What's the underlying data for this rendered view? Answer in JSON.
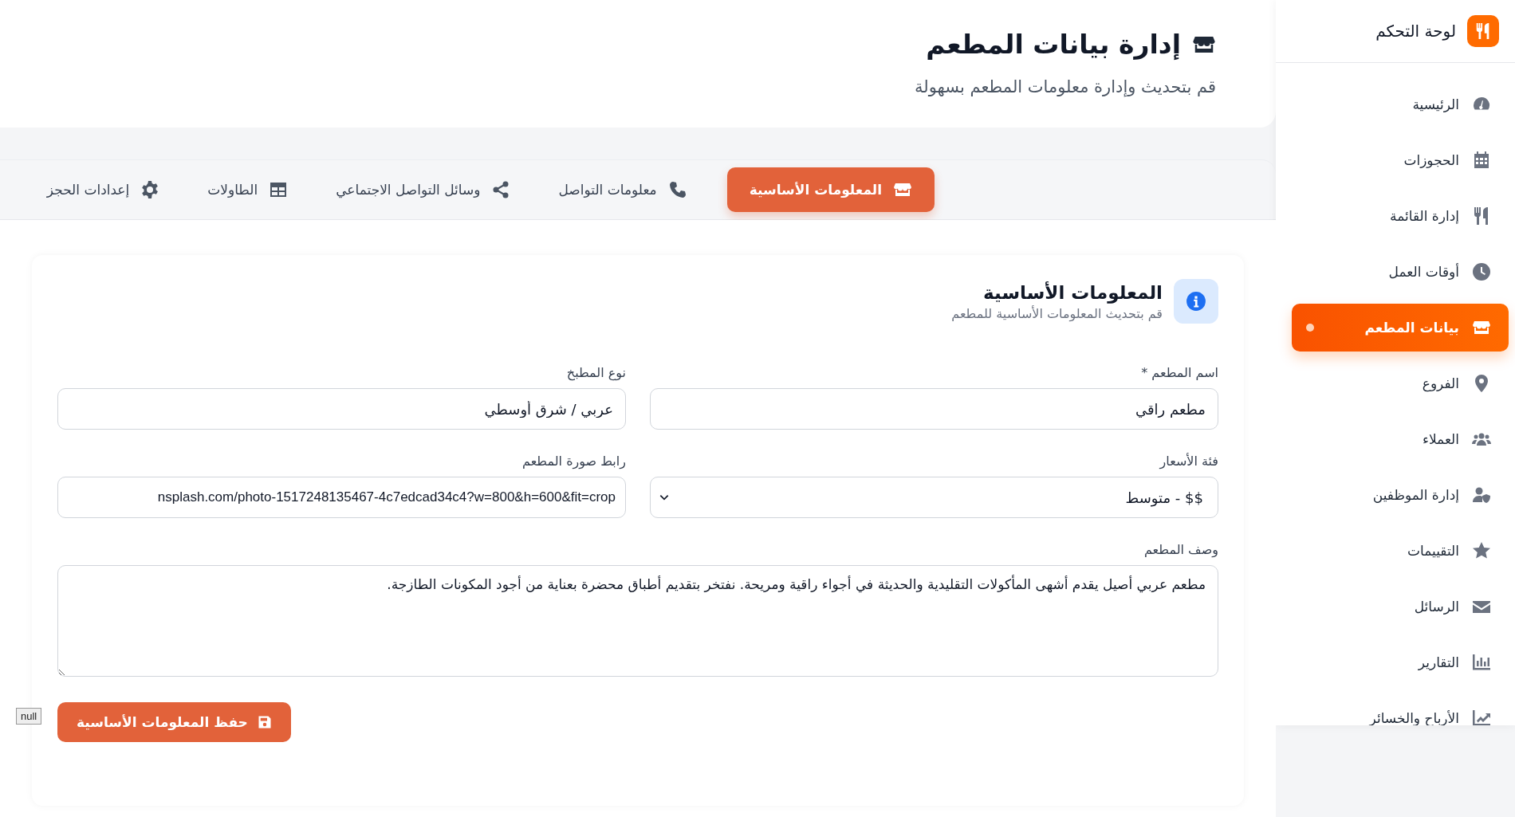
{
  "page_header": {
    "title": "إدارة بيانات المطعم",
    "subtitle": "قم بتحديث وإدارة معلومات المطعم بسهولة"
  },
  "tabs": [
    {
      "label": "المعلومات الأساسية",
      "kind": "store",
      "selected": true
    },
    {
      "label": "معلومات التواصل",
      "kind": "phone",
      "selected": false
    },
    {
      "label": "وسائل التواصل الاجتماعي",
      "kind": "share",
      "selected": false
    },
    {
      "label": "الطاولات",
      "kind": "table",
      "selected": false
    },
    {
      "label": "إعدادات الحجز",
      "kind": "gear",
      "selected": false
    }
  ],
  "section": {
    "title": "المعلومات الأساسية",
    "subtitle": "قم بتحديث المعلومات الأساسية للمطعم"
  },
  "fields": [
    {
      "kind": "input",
      "label": "اسم المطعم *",
      "value": "مطعم راقي"
    },
    {
      "kind": "input",
      "label": "نوع المطبخ",
      "value": "عربي / شرق أوسطي"
    },
    {
      "kind": "select",
      "label": "فئة الأسعار",
      "value": "$$ - متوسط"
    },
    {
      "kind": "url",
      "label": "رابط صورة المطعم",
      "value": "nsplash.com/photo-1517248135467-4c7edcad34c4?w=800&h=600&fit=crop"
    },
    {
      "kind": "textarea",
      "label": "وصف المطعم",
      "value": "مطعم عربي أصيل يقدم أشهى المأكولات التقليدية والحديثة في أجواء راقية ومريحة. نفتخر بتقديم أطباق محضرة بعناية من أجود المكونات الطازجة."
    }
  ],
  "null_tag": "null",
  "save_button": "حفظ المعلومات الأساسية",
  "sidebar": {
    "title": "لوحة التحكم",
    "items": [
      {
        "label": "الرئيسية",
        "kind": "gauge",
        "selected": false
      },
      {
        "label": "الحجوزات",
        "kind": "calendar",
        "selected": false
      },
      {
        "label": "إدارة القائمة",
        "kind": "utensils",
        "selected": false
      },
      {
        "label": "أوقات العمل",
        "kind": "clock",
        "selected": false
      },
      {
        "label": "بيانات المطعم",
        "kind": "store",
        "selected": true
      },
      {
        "label": "الفروع",
        "kind": "pin",
        "selected": false
      },
      {
        "label": "العملاء",
        "kind": "users",
        "selected": false
      },
      {
        "label": "إدارة الموظفين",
        "kind": "usershield",
        "selected": false
      },
      {
        "label": "التقييمات",
        "kind": "star",
        "selected": false
      },
      {
        "label": "الرسائل",
        "kind": "envelope",
        "selected": false
      },
      {
        "label": "التقارير",
        "kind": "chart",
        "selected": false
      },
      {
        "label": "الأرباح والخسائر",
        "kind": "trend",
        "selected": false
      }
    ]
  }
}
